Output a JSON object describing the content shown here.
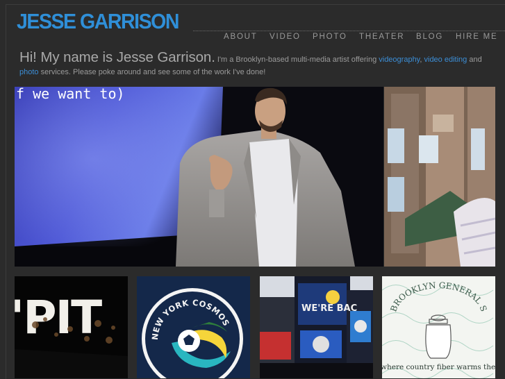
{
  "site": {
    "logo_text": "JESSE GARRISON"
  },
  "nav": {
    "items": [
      "ABOUT",
      "VIDEO",
      "PHOTO",
      "THEATER",
      "BLOG",
      "HIRE ME"
    ]
  },
  "intro": {
    "headline": "Hi! My name is Jesse Garrison.",
    "text_1": " I'm a Brooklyn-based multi-media artist offering ",
    "link_videography": "videography",
    "text_2": ", ",
    "link_video_editing": "video editing",
    "text_3": " and ",
    "link_photo": "photo",
    "text_4": " services. Please poke around and see some of the work I've done!"
  },
  "hero": {
    "projected_text": "f we want to)"
  },
  "thumbnails": {
    "pit_text": "'PIT",
    "cosmos_text": "NEW YORK COSMOS",
    "times_square_text": "WE'RE BAC",
    "store_title": "BROOKLYN GENERAL STORE",
    "store_tagline": "where country fiber warms the big city"
  },
  "colors": {
    "background": "#2b2b2b",
    "brand_blue": "#2f8fd8",
    "link_blue": "#3c8ed6",
    "nav_gray": "#9a9a9a"
  }
}
